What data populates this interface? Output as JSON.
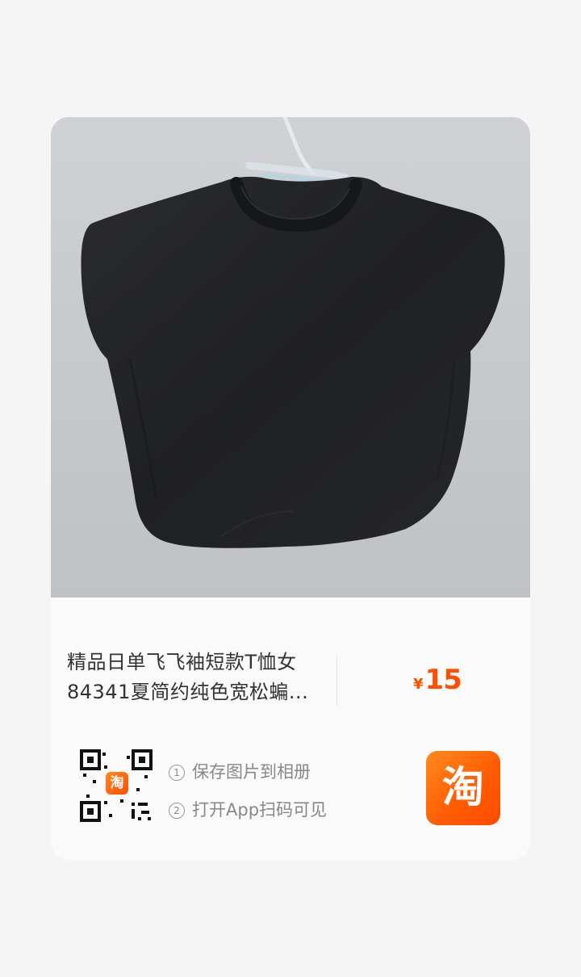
{
  "product": {
    "image_alt": "black flying-sleeve cropped t-shirt on a clear hanger",
    "title_line1": "精品日单飞飞袖短款T恤女",
    "title_line2": "84341夏简约纯色宽松蝙...",
    "currency": "¥",
    "price": "15"
  },
  "share": {
    "step1_num": "1",
    "step1_label": "保存图片到相册",
    "step2_num": "2",
    "step2_label": "打开App扫码可见",
    "qr_logo_char": "淘",
    "app_logo_char": "淘"
  },
  "colors": {
    "page_bg": "#f5f5f5",
    "price": "#ff5000",
    "brand": "#ff5a00"
  }
}
